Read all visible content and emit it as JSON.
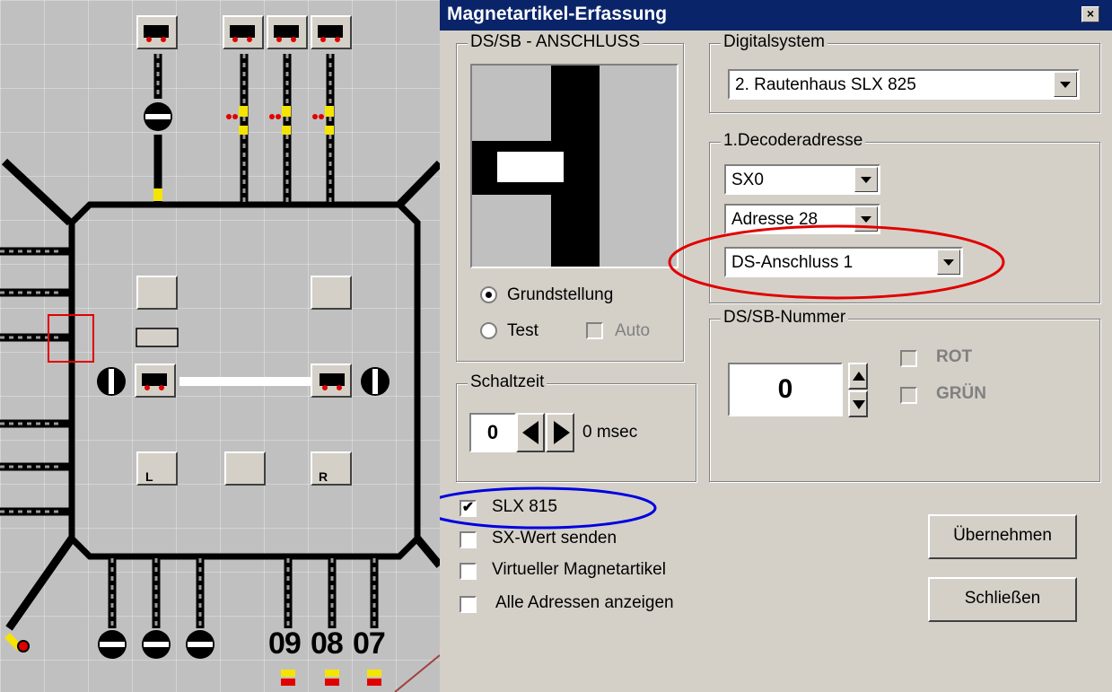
{
  "plan": {
    "labels": [
      "09",
      "08",
      "07"
    ]
  },
  "dialog": {
    "title": "Magnetartikel-Erfassung",
    "close_label": "×",
    "dssb_group": {
      "legend": "DS/SB - ANSCHLUSS",
      "radio_grundstellung": "Grundstellung",
      "radio_test": "Test",
      "chk_auto": "Auto"
    },
    "schaltzeit": {
      "legend": "Schaltzeit",
      "value": "0",
      "unit": "0 msec"
    },
    "digitalsystem": {
      "legend": "Digitalsystem",
      "value": "2. Rautenhaus SLX 825"
    },
    "decoder": {
      "legend": "1.Decoderadresse",
      "bus": "SX0",
      "address": "Adresse 28",
      "anschluss": "DS-Anschluss 1"
    },
    "dssb_nummer": {
      "legend": "DS/SB-Nummer",
      "value": "0",
      "rot": "ROT",
      "gruen": "GRÜN"
    },
    "checks": {
      "slx815": "SLX 815",
      "sxwert": "SX-Wert senden",
      "virtuell": "Virtueller Magnetartikel",
      "alle": "Alle Adressen anzeigen"
    },
    "buttons": {
      "uebernehmen": "Übernehmen",
      "schliessen": "Schließen"
    }
  },
  "colors": {
    "titlebar": "#0a246a",
    "red_highlight": "#e00000",
    "blue_highlight": "#0000e0"
  }
}
